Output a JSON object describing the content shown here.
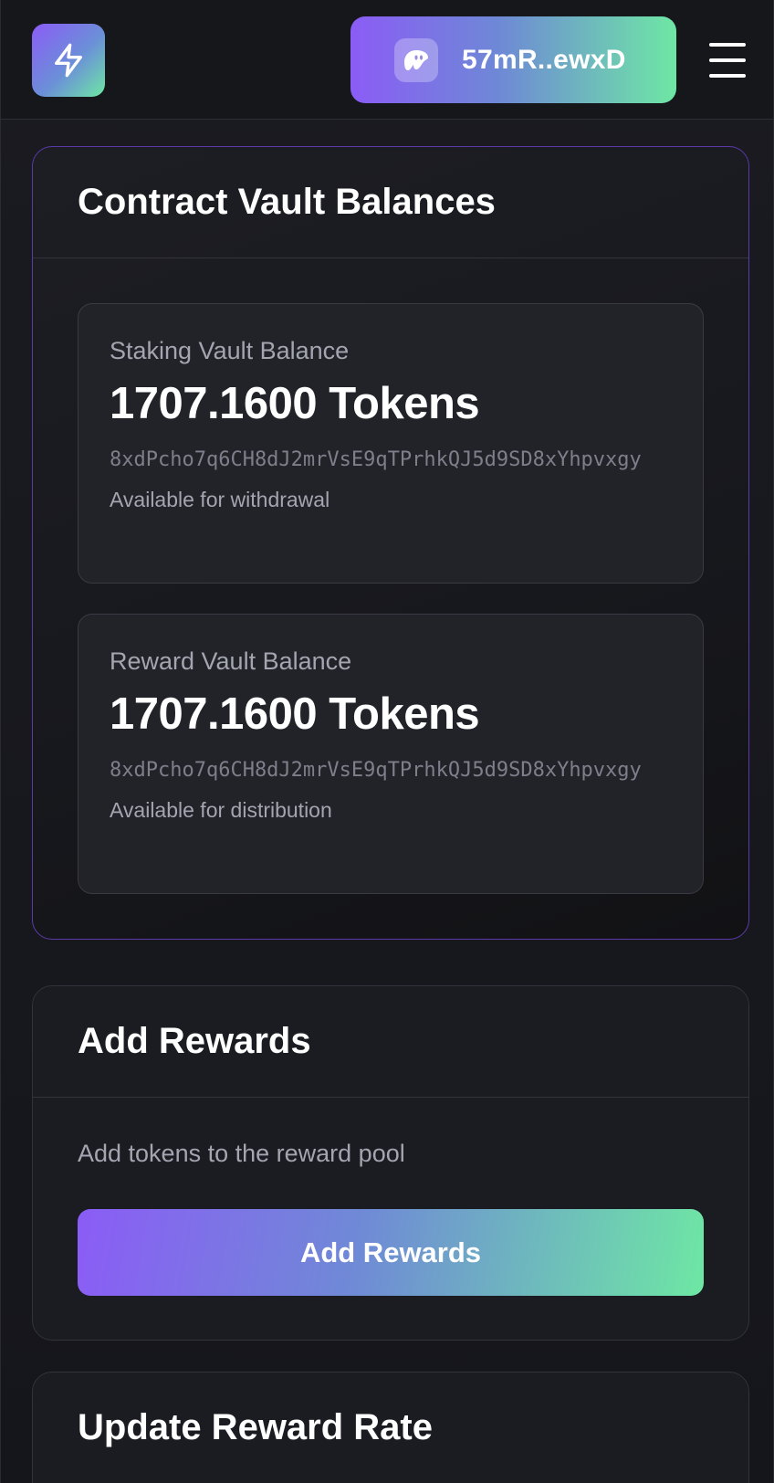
{
  "header": {
    "wallet_address": "57mR..ewxD"
  },
  "vault": {
    "title": "Contract Vault Balances",
    "staking": {
      "label": "Staking Vault Balance",
      "value": "1707.1600 Tokens",
      "address": "8xdPcho7q6CH8dJ2mrVsE9qTPrhkQJ5d9SD8xYhpvxgy",
      "note": "Available for withdrawal"
    },
    "reward": {
      "label": "Reward Vault Balance",
      "value": "1707.1600 Tokens",
      "address": "8xdPcho7q6CH8dJ2mrVsE9qTPrhkQJ5d9SD8xYhpvxgy",
      "note": "Available for distribution"
    }
  },
  "add_rewards": {
    "title": "Add Rewards",
    "description": "Add tokens to the reward pool",
    "button_label": "Add Rewards"
  },
  "update_rate": {
    "title": "Update Reward Rate"
  },
  "colors": {
    "accent_start": "#8b5cf6",
    "accent_end": "#6ee7a4",
    "background": "#16171c",
    "vault_border": "#5b3aa8"
  },
  "icons": {
    "logo": "lightning-bolt-icon",
    "wallet": "ghost-icon",
    "menu": "hamburger-menu-icon"
  }
}
